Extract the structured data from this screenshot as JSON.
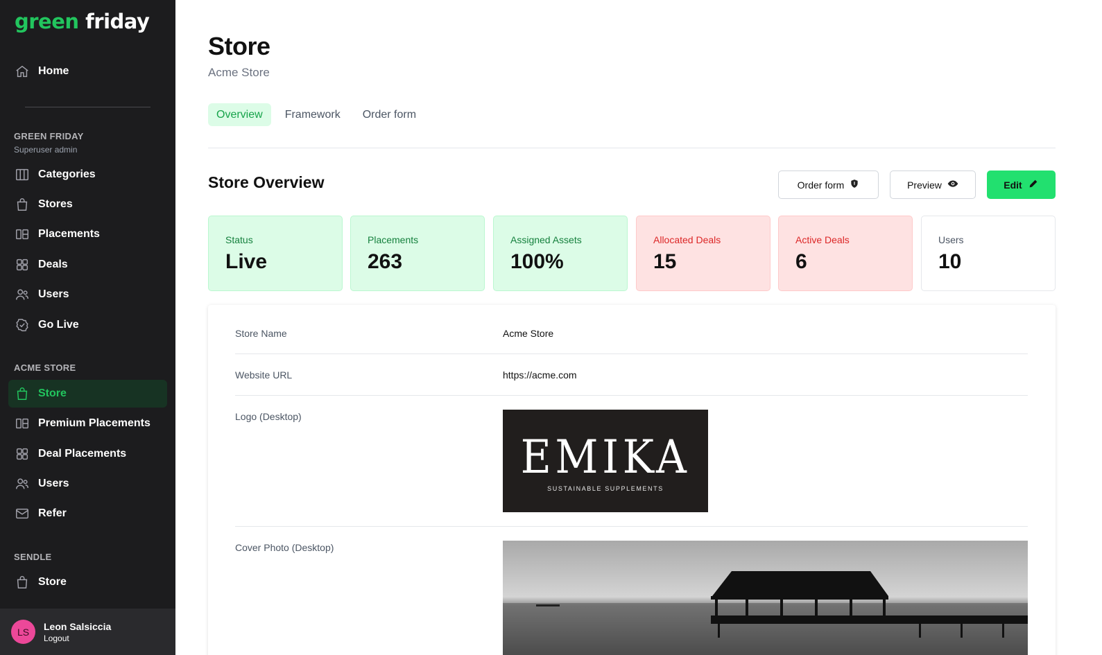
{
  "brand": {
    "part1": "green",
    "part2": "friday"
  },
  "sidebar": {
    "home": "Home",
    "org_section": {
      "title": "GREEN FRIDAY",
      "subtitle": "Superuser admin"
    },
    "org_items": [
      "Categories",
      "Stores",
      "Placements",
      "Deals",
      "Users",
      "Go Live"
    ],
    "store_section": {
      "title": "ACME STORE"
    },
    "store_items": [
      "Store",
      "Premium Placements",
      "Deal Placements",
      "Users",
      "Refer"
    ],
    "sendle_section": {
      "title": "SENDLE"
    },
    "sendle_items": [
      "Store"
    ],
    "user": {
      "initials": "LS",
      "name": "Leon Salsiccia",
      "logout": "Logout"
    }
  },
  "header": {
    "title": "Store",
    "subtitle": "Acme Store"
  },
  "tabs": [
    "Overview",
    "Framework",
    "Order form"
  ],
  "overview": {
    "title": "Store Overview",
    "buttons": {
      "order_form": "Order form",
      "preview": "Preview",
      "edit": "Edit"
    }
  },
  "stats": [
    {
      "label": "Status",
      "value": "Live",
      "tone": "green"
    },
    {
      "label": "Placements",
      "value": "263",
      "tone": "green"
    },
    {
      "label": "Assigned Assets",
      "value": "100%",
      "tone": "green"
    },
    {
      "label": "Allocated Deals",
      "value": "15",
      "tone": "red"
    },
    {
      "label": "Active Deals",
      "value": "6",
      "tone": "red"
    },
    {
      "label": "Users",
      "value": "10",
      "tone": "white"
    }
  ],
  "details": {
    "store_name": {
      "label": "Store Name",
      "value": "Acme Store"
    },
    "website": {
      "label": "Website URL",
      "value": "https://acme.com"
    },
    "logo": {
      "label": "Logo (Desktop)",
      "brand_text": "EMIKA",
      "tagline": "SUSTAINABLE SUPPLEMENTS"
    },
    "cover": {
      "label": "Cover Photo (Desktop)"
    }
  },
  "colors": {
    "accent": "#22c55e",
    "sidebar_bg": "#1c1c1e",
    "danger": "#dc2626"
  }
}
